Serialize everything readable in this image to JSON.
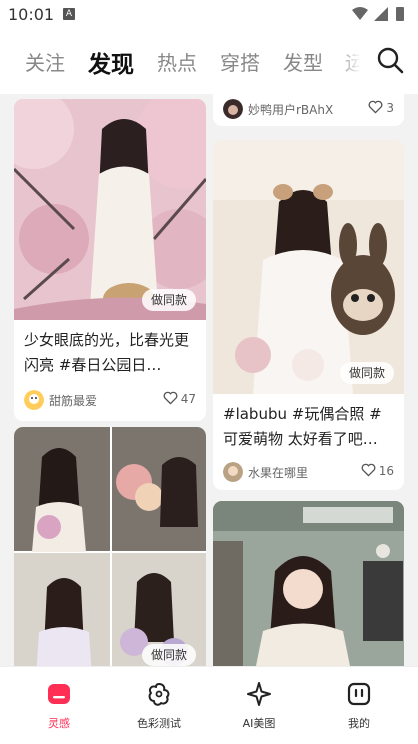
{
  "status_bar": {
    "time": "10:01",
    "badge": "A"
  },
  "top_nav": {
    "tabs": [
      {
        "label": "关注",
        "active": false
      },
      {
        "label": "发现",
        "active": true
      },
      {
        "label": "热点",
        "active": false
      },
      {
        "label": "穿搭",
        "active": false
      },
      {
        "label": "发型",
        "active": false
      },
      {
        "label": "运",
        "active": false
      }
    ],
    "search_icon": "search-icon"
  },
  "feed": {
    "same_button_label": "做同款",
    "cards": [
      {
        "title": "少女眼底的光，比春光更闪亮 #春日公园日…",
        "author": "甜筋最爱",
        "likes": "47"
      },
      {
        "title": "",
        "author": "妙鸭用户rBAhX",
        "likes": "3"
      },
      {
        "title": "#labubu #玩偶合照 #可爱萌物 太好看了吧…",
        "author": "水果在哪里",
        "likes": "16"
      },
      {
        "title": "",
        "author": "",
        "likes": ""
      },
      {
        "title": "",
        "author": "",
        "likes": ""
      }
    ]
  },
  "bottom_nav": {
    "items": [
      {
        "label": "灵感",
        "icon": "inspiration-icon",
        "active": true
      },
      {
        "label": "色彩测试",
        "icon": "palette-icon",
        "active": false
      },
      {
        "label": "AI美图",
        "icon": "sparkle-icon",
        "active": false
      },
      {
        "label": "我的",
        "icon": "profile-icon",
        "active": false
      }
    ]
  },
  "colors": {
    "accent": "#ff2e55",
    "active_text": "#111111",
    "inactive_text": "#888888"
  }
}
